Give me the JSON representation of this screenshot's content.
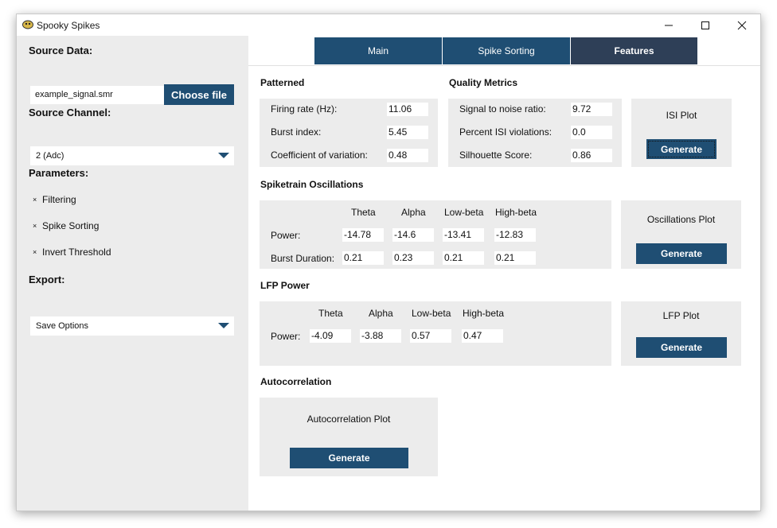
{
  "window": {
    "title": "Spooky Spikes"
  },
  "sidebar": {
    "source_data_heading": "Source Data:",
    "file_name": "example_signal.smr",
    "choose_file_label": "Choose file",
    "source_channel_heading": "Source Channel:",
    "channel_selected": "2 (Adc)",
    "parameters_heading": "Parameters:",
    "options": [
      {
        "label": "Filtering",
        "mark": "×"
      },
      {
        "label": "Spike Sorting",
        "mark": "×"
      },
      {
        "label": "Invert Threshold",
        "mark": "×"
      }
    ],
    "export_heading": "Export:",
    "export_selected": "Save Options"
  },
  "tabs": [
    {
      "label": "Main",
      "active": false
    },
    {
      "label": "Spike Sorting",
      "active": false
    },
    {
      "label": "Features",
      "active": true
    }
  ],
  "patterned": {
    "heading": "Patterned",
    "rows": [
      {
        "label": "Firing rate (Hz):",
        "value": "11.06"
      },
      {
        "label": "Burst index:",
        "value": "5.45"
      },
      {
        "label": "Coefficient of variation:",
        "value": "0.48"
      }
    ]
  },
  "quality": {
    "heading": "Quality Metrics",
    "rows": [
      {
        "label": "Signal to noise ratio:",
        "value": "9.72"
      },
      {
        "label": "Percent ISI violations:",
        "value": "0.0"
      },
      {
        "label": "Silhouette Score:",
        "value": "0.86"
      }
    ]
  },
  "isi_plot": {
    "title": "ISI Plot",
    "button": "Generate"
  },
  "oscillations": {
    "heading": "Spiketrain Oscillations",
    "columns": [
      "Theta",
      "Alpha",
      "Low-beta",
      "High-beta"
    ],
    "power_label": "Power:",
    "power": [
      "-14.78",
      "-14.6",
      "-13.41",
      "-12.83"
    ],
    "burst_label": "Burst Duration:",
    "burst": [
      "0.21",
      "0.23",
      "0.21",
      "0.21"
    ]
  },
  "osc_plot": {
    "title": "Oscillations Plot",
    "button": "Generate"
  },
  "lfp": {
    "heading": "LFP Power",
    "columns": [
      "Theta",
      "Alpha",
      "Low-beta",
      "High-beta"
    ],
    "power_label": "Power:",
    "power": [
      "-4.09",
      "-3.88",
      "0.57",
      "0.47"
    ]
  },
  "lfp_plot": {
    "title": "LFP Plot",
    "button": "Generate"
  },
  "autocorrelation": {
    "heading": "Autocorrelation",
    "plot_title": "Autocorrelation Plot",
    "button": "Generate"
  },
  "colors": {
    "accent": "#1f4e73",
    "active_tab": "#2e3f57",
    "panel": "#ececec"
  }
}
